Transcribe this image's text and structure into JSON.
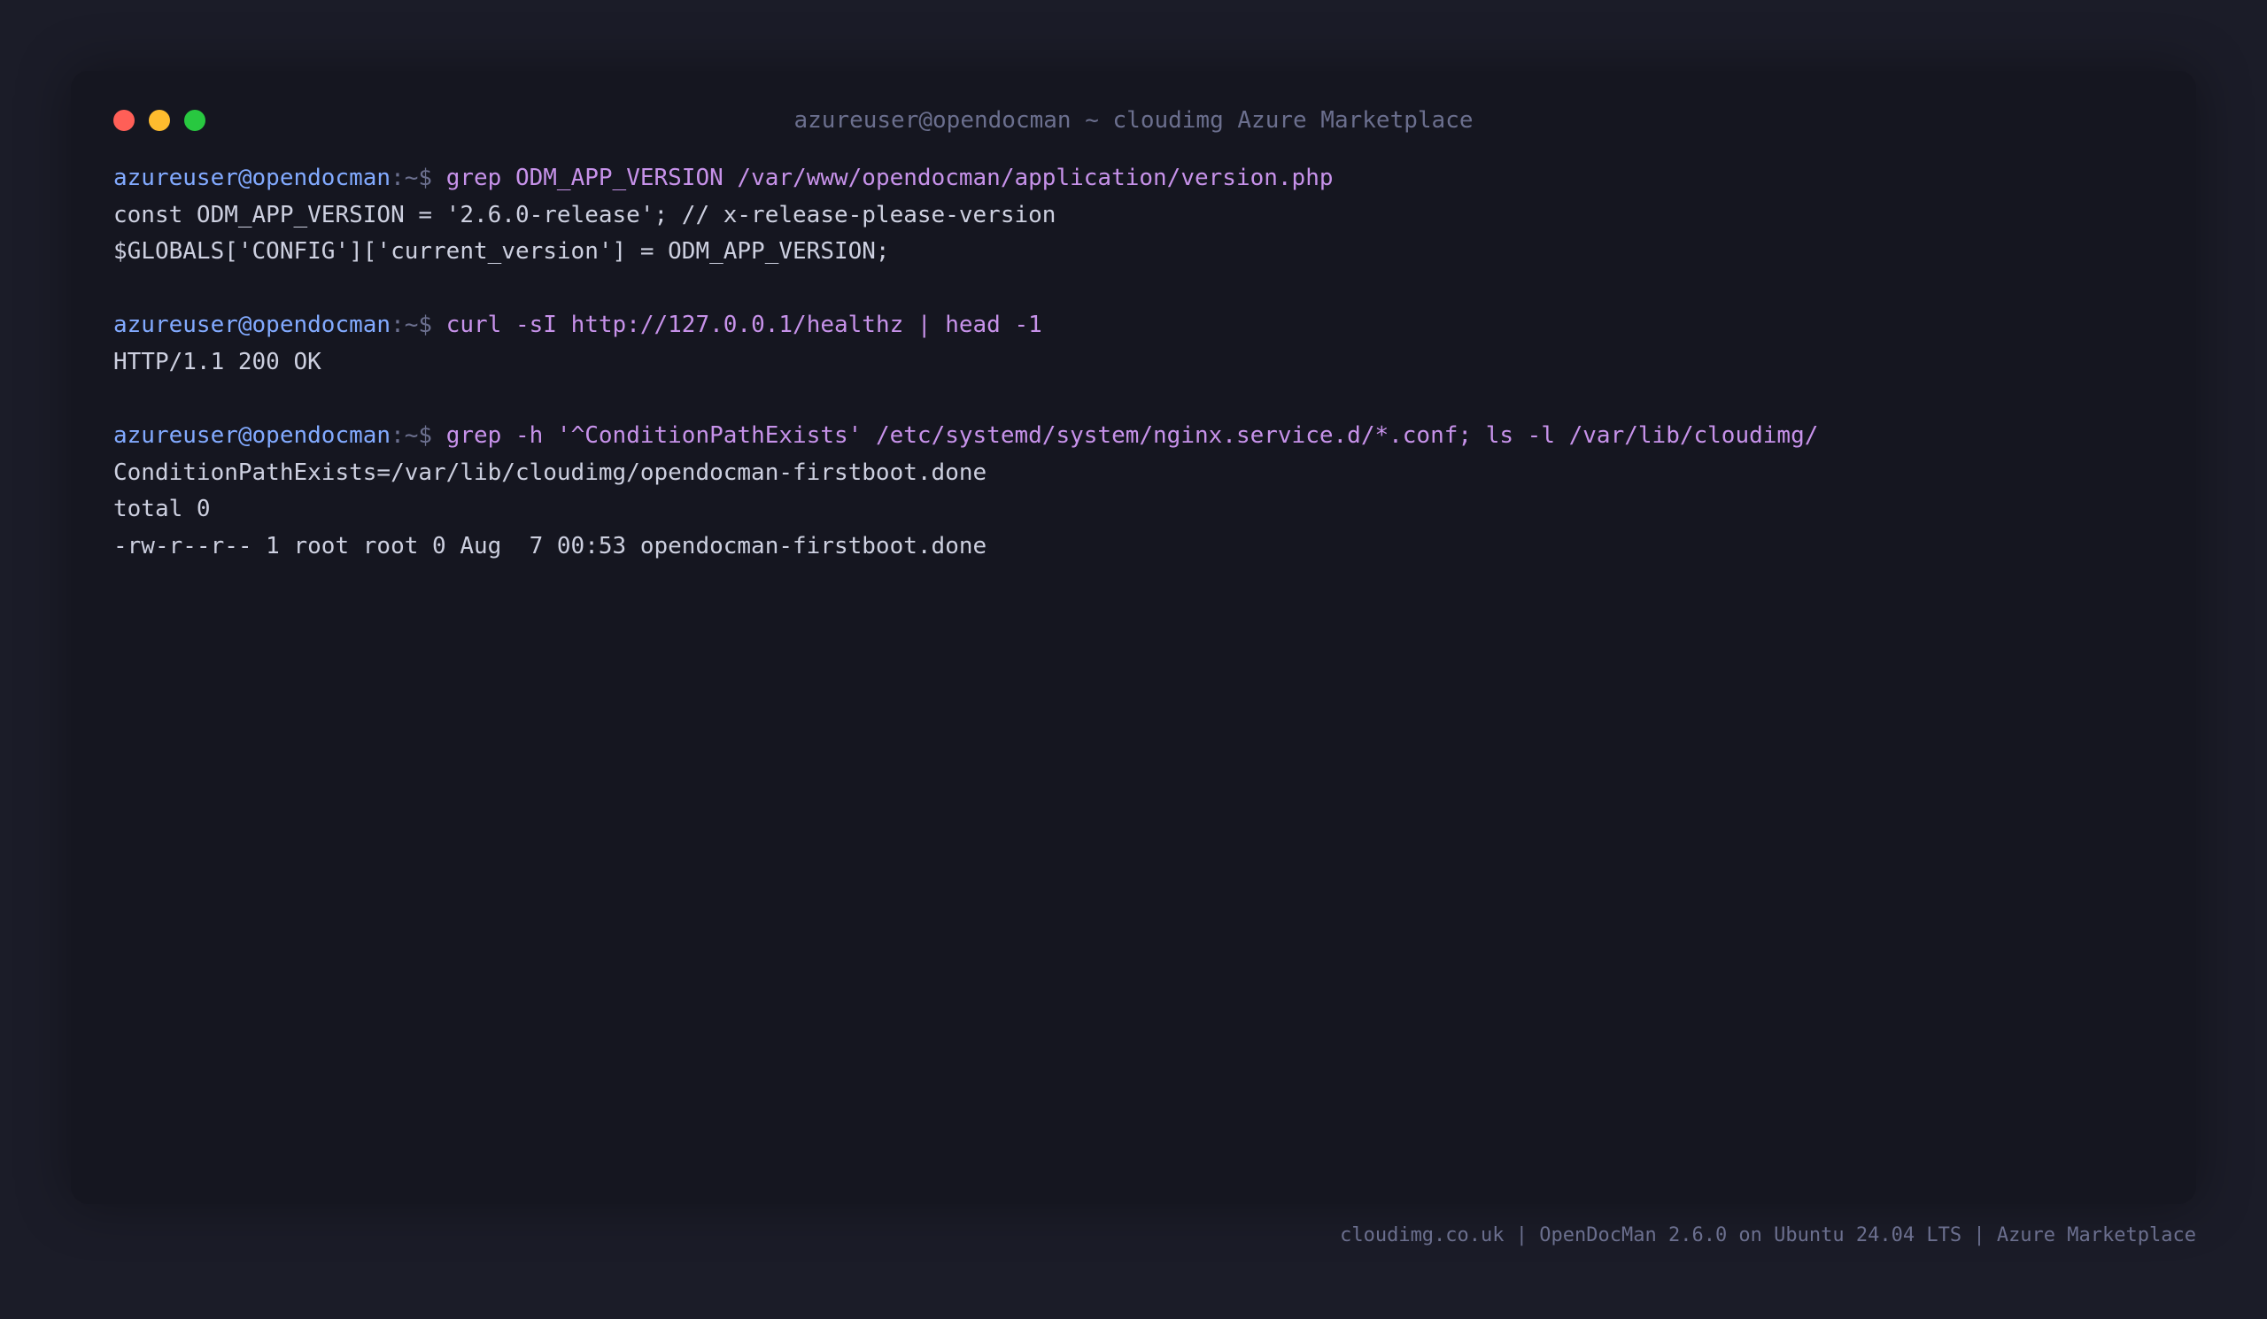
{
  "window": {
    "title": "azureuser@opendocman ~ cloudimg Azure Marketplace"
  },
  "prompt": {
    "user_host": "azureuser@opendocman",
    "path_symbol": ":~$"
  },
  "blocks": [
    {
      "command": "grep ODM_APP_VERSION /var/www/opendocman/application/version.php",
      "output": [
        "const ODM_APP_VERSION = '2.6.0-release'; // x-release-please-version",
        "$GLOBALS['CONFIG']['current_version'] = ODM_APP_VERSION;"
      ]
    },
    {
      "command": "curl -sI http://127.0.0.1/healthz | head -1",
      "output": [
        "HTTP/1.1 200 OK"
      ]
    },
    {
      "command": "grep -h '^ConditionPathExists' /etc/systemd/system/nginx.service.d/*.conf; ls -l /var/lib/cloudimg/",
      "output": [
        "ConditionPathExists=/var/lib/cloudimg/opendocman-firstboot.done",
        "total 0",
        "-rw-r--r-- 1 root root 0 Aug  7 00:53 opendocman-firstboot.done"
      ]
    }
  ],
  "footer": {
    "text": "cloudimg.co.uk | OpenDocMan 2.6.0 on Ubuntu 24.04 LTS | Azure Marketplace"
  },
  "colors": {
    "background": "#1b1c28",
    "window": "#151620",
    "user": "#82aaff",
    "command": "#c792ea",
    "output": "#cdd0e0",
    "muted": "#6b6f8e",
    "close": "#ff5f57",
    "minimize": "#febc2e",
    "maximize": "#28c840"
  }
}
